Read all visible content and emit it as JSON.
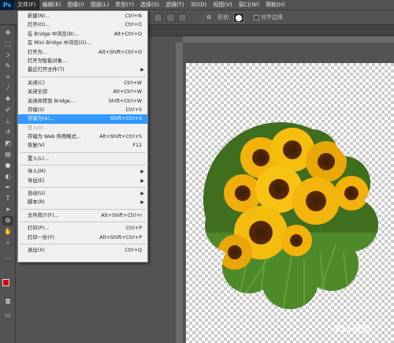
{
  "app": {
    "logo": "Ps"
  },
  "menubar": [
    {
      "label": "文件(F)",
      "active": true
    },
    {
      "label": "编辑(E)"
    },
    {
      "label": "图像(I)"
    },
    {
      "label": "图层(L)"
    },
    {
      "label": "类型(Y)"
    },
    {
      "label": "选择(S)"
    },
    {
      "label": "滤镜(T)"
    },
    {
      "label": "3D(D)"
    },
    {
      "label": "视图(V)"
    },
    {
      "label": "窗口(W)"
    },
    {
      "label": "帮助(H)"
    }
  ],
  "options": {
    "shape_label": "形状:",
    "align_edges_label": "对齐边缘"
  },
  "file_menu": [
    {
      "label": "新建(N)...",
      "shortcut": "Ctrl+N"
    },
    {
      "label": "打开(O)...",
      "shortcut": "Ctrl+O"
    },
    {
      "label": "在 Bridge 中浏览(B)...",
      "shortcut": "Alt+Ctrl+O"
    },
    {
      "label": "在 Mini Bridge 中浏览(G)...",
      "shortcut": ""
    },
    {
      "label": "打开为...",
      "shortcut": "Alt+Shift+Ctrl+O"
    },
    {
      "label": "打开为智能对象...",
      "shortcut": ""
    },
    {
      "label": "最近打开文件(T)",
      "shortcut": "",
      "submenu": true
    },
    {
      "sep": true
    },
    {
      "label": "关闭(C)",
      "shortcut": "Ctrl+W"
    },
    {
      "label": "关闭全部",
      "shortcut": "Alt+Ctrl+W"
    },
    {
      "label": "关闭并转到 Bridge...",
      "shortcut": "Shift+Ctrl+W"
    },
    {
      "label": "存储(S)",
      "shortcut": "Ctrl+S"
    },
    {
      "label": "存储为(A)...",
      "shortcut": "Shift+Ctrl+S",
      "highlighted": true
    },
    {
      "label": "签入(I)...",
      "shortcut": "",
      "disabled": true
    },
    {
      "label": "存储为 Web 所用格式...",
      "shortcut": "Alt+Shift+Ctrl+S"
    },
    {
      "label": "恢复(V)",
      "shortcut": "F12"
    },
    {
      "sep": true
    },
    {
      "label": "置入(L)...",
      "shortcut": ""
    },
    {
      "sep": true
    },
    {
      "label": "导入(M)",
      "shortcut": "",
      "submenu": true
    },
    {
      "label": "导出(E)",
      "shortcut": "",
      "submenu": true
    },
    {
      "sep": true
    },
    {
      "label": "自动(U)",
      "shortcut": "",
      "submenu": true
    },
    {
      "label": "脚本(R)",
      "shortcut": "",
      "submenu": true
    },
    {
      "sep": true
    },
    {
      "label": "文件简介(F)...",
      "shortcut": "Alt+Shift+Ctrl+I"
    },
    {
      "sep": true
    },
    {
      "label": "打印(P)...",
      "shortcut": "Ctrl+P"
    },
    {
      "label": "打印一份(Y)",
      "shortcut": "Alt+Shift+Ctrl+P"
    },
    {
      "sep": true
    },
    {
      "label": "退出(X)",
      "shortcut": "Ctrl+Q"
    }
  ],
  "colors": {
    "foreground": "#e10000",
    "background": "#ffffff",
    "highlight": "#3399ff"
  },
  "watermark": "Bai 经验"
}
